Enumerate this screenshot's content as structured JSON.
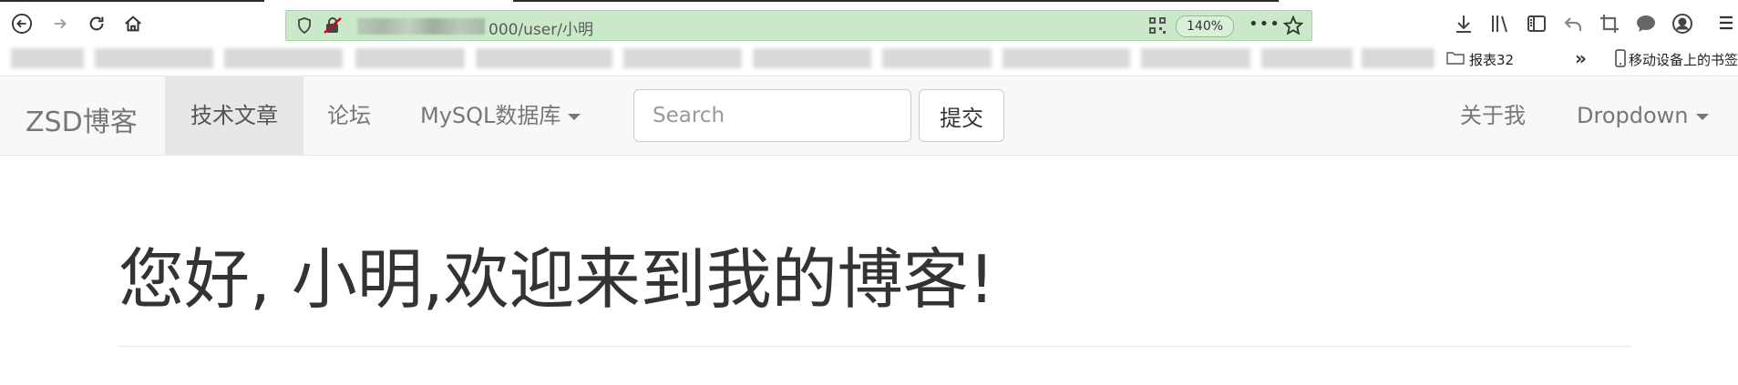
{
  "browser": {
    "url_visible": "000/user/小明",
    "zoom": "140%",
    "bookmarks": [
      {
        "label": "报表32",
        "type": "folder"
      },
      {
        "label": "移动设备上的书签",
        "type": "mobile"
      }
    ]
  },
  "navbar": {
    "brand": "ZSD博客",
    "items": [
      {
        "label": "技术文章",
        "active": true
      },
      {
        "label": "论坛",
        "active": false
      },
      {
        "label": "MySQL数据库",
        "dropdown": true
      }
    ],
    "search": {
      "placeholder": "Search",
      "value": ""
    },
    "submit_label": "提交",
    "right_items": [
      {
        "label": "关于我"
      },
      {
        "label": "Dropdown",
        "dropdown": true
      }
    ]
  },
  "page": {
    "title": "您好, 小明,欢迎来到我的博客!"
  },
  "colors": {
    "urlbar_bg": "#c9e9c9",
    "navbar_bg": "#f8f8f8",
    "active_nav_bg": "#e7e7e7",
    "nav_text": "#777777"
  }
}
